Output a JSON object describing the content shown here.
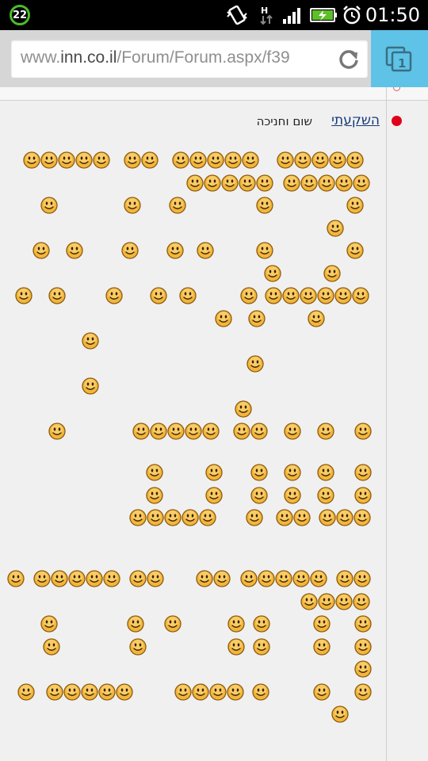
{
  "status_bar": {
    "notification_count": "22",
    "time": "01:50",
    "icons": [
      "vibrate-icon",
      "data-arrows-icon",
      "signal-icon",
      "battery-charging-icon",
      "alarm-icon"
    ]
  },
  "browser": {
    "url_prefix": "www.",
    "url_host": "inn.co.il",
    "url_path": "/Forum/Forum.aspx/f39",
    "tab_count": "1",
    "accent_color": "#5ec3e6"
  },
  "forum": {
    "post_title": "השקעתי",
    "post_subtitle": "שום וחניכה",
    "smiley_art_rows": [
      [
        40,
        62,
        84,
        106,
        128,
        167,
        189,
        228,
        250,
        272,
        294,
        316,
        360,
        382,
        404,
        426,
        448
      ],
      [
        246,
        268,
        290,
        312,
        334,
        368,
        390,
        412,
        434,
        456
      ],
      [
        62,
        167,
        224,
        334,
        448
      ],
      [
        423
      ],
      [
        52,
        94,
        164,
        221,
        259,
        334,
        448
      ],
      [
        344,
        419
      ],
      [
        30,
        72,
        144,
        200,
        237,
        314,
        345,
        367,
        389,
        411,
        433,
        455
      ],
      [
        282,
        324,
        399
      ],
      [
        114
      ],
      [
        322
      ],
      [
        114
      ],
      [
        307
      ],
      [
        72,
        178,
        200,
        222,
        244,
        266,
        305,
        327,
        369,
        411,
        458
      ],
      [],
      [
        195,
        270,
        327,
        369,
        411,
        458
      ],
      [
        195,
        270,
        327,
        369,
        411,
        458
      ],
      [
        174,
        196,
        218,
        240,
        262,
        321,
        359,
        381,
        413,
        435,
        457
      ],
      [],
      [],
      [
        20,
        53,
        75,
        97,
        119,
        141,
        174,
        196,
        258,
        280,
        314,
        336,
        358,
        380,
        402,
        435,
        457
      ],
      [
        390,
        412,
        434,
        456
      ],
      [
        62,
        171,
        218,
        298,
        330,
        406,
        458
      ],
      [
        65,
        174,
        298,
        330,
        406,
        458
      ],
      [
        458
      ],
      [
        33,
        69,
        91,
        113,
        135,
        157,
        231,
        253,
        275,
        297,
        329,
        406,
        458
      ],
      [
        429
      ]
    ]
  }
}
